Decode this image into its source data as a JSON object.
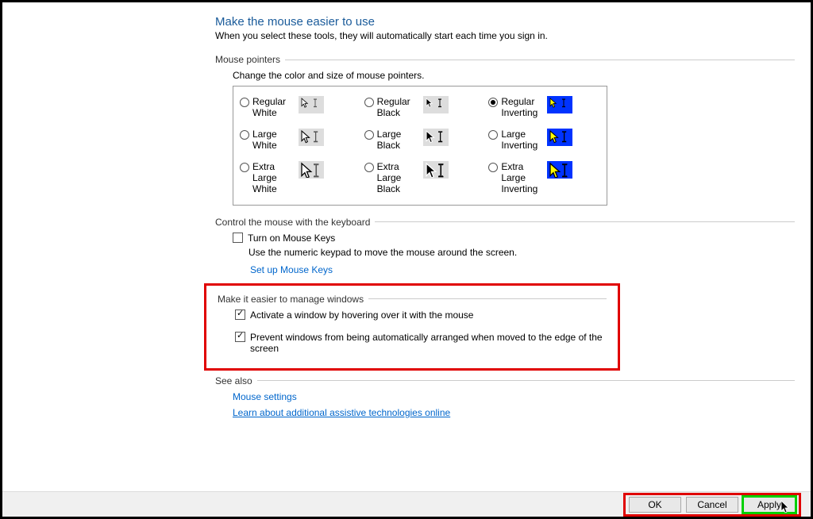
{
  "page": {
    "title": "Make the mouse easier to use",
    "subtitle": "When you select these tools, they will automatically start each time you sign in."
  },
  "pointers": {
    "header": "Mouse pointers",
    "caption": "Change the color and size of mouse pointers.",
    "options": [
      {
        "label": "Regular White",
        "theme": "white",
        "checked": false
      },
      {
        "label": "Regular Black",
        "theme": "black",
        "checked": false
      },
      {
        "label": "Regular Inverting",
        "theme": "invert",
        "checked": true
      },
      {
        "label": "Large White",
        "theme": "white",
        "checked": false
      },
      {
        "label": "Large Black",
        "theme": "black",
        "checked": false
      },
      {
        "label": "Large Inverting",
        "theme": "invert",
        "checked": false
      },
      {
        "label": "Extra Large White",
        "theme": "white",
        "checked": false
      },
      {
        "label": "Extra Large Black",
        "theme": "black",
        "checked": false
      },
      {
        "label": "Extra Large Inverting",
        "theme": "invert",
        "checked": false
      }
    ]
  },
  "keyboard": {
    "header": "Control the mouse with the keyboard",
    "mousekeys_label": "Turn on Mouse Keys",
    "mousekeys_checked": false,
    "mousekeys_help": "Use the numeric keypad to move the mouse around the screen.",
    "setup_link": "Set up Mouse Keys"
  },
  "windows": {
    "header": "Make it easier to manage windows",
    "activate_label": "Activate a window by hovering over it with the mouse",
    "activate_checked": true,
    "snap_label": "Prevent windows from being automatically arranged when moved to the edge of the screen",
    "snap_checked": true
  },
  "seealso": {
    "header": "See also",
    "link1": "Mouse settings",
    "link2": "Learn about additional assistive technologies online"
  },
  "footer": {
    "ok": "OK",
    "cancel": "Cancel",
    "apply": "Apply"
  }
}
